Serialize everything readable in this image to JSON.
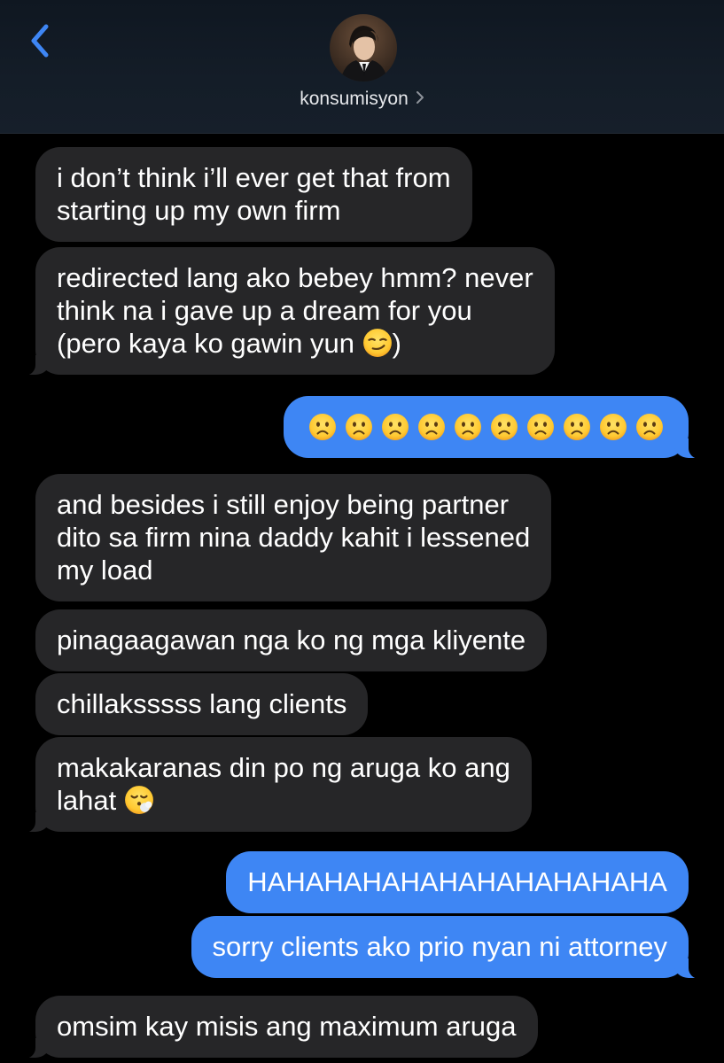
{
  "header": {
    "contact_name": "konsumisyon",
    "back_icon": "chevron-left-icon",
    "detail_icon": "chevron-right-icon",
    "accent": "#3e86f4"
  },
  "messages": [
    {
      "side": "in",
      "text_lines": [
        "i don’t think i’ll ever get that from",
        "starting up my own firm"
      ]
    },
    {
      "side": "in",
      "text_lines": [
        "redirected lang ako bebey hmm? never",
        "think na i gave up a dream for you",
        "(pero kaya ko gawin yun",
        ")"
      ],
      "emoji": "smirking-face"
    },
    {
      "side": "out",
      "emoji_count": 10,
      "emoji": "frowning-face"
    },
    {
      "side": "in",
      "text_lines": [
        "and besides i still enjoy being partner",
        "dito sa firm nina daddy kahit i lessened",
        "my load"
      ]
    },
    {
      "side": "in",
      "text": "pinagaagawan nga ko ng mga kliyente"
    },
    {
      "side": "in",
      "text": "chillaksssss lang clients"
    },
    {
      "side": "in",
      "text_lines": [
        "makakaranas din po ng aruga ko ang",
        "lahat"
      ],
      "emoji": "face-exhaling"
    },
    {
      "side": "out",
      "text": "HAHAHAHAHAHAHAHAHAHAHA"
    },
    {
      "side": "out",
      "text": "sorry clients ako prio nyan ni attorney"
    },
    {
      "side": "in",
      "text": "omsim kay misis ang maximum aruga"
    }
  ],
  "colors": {
    "incoming_bubble": "#262628",
    "outgoing_bubble": "#3e86f4",
    "background": "#000000"
  }
}
